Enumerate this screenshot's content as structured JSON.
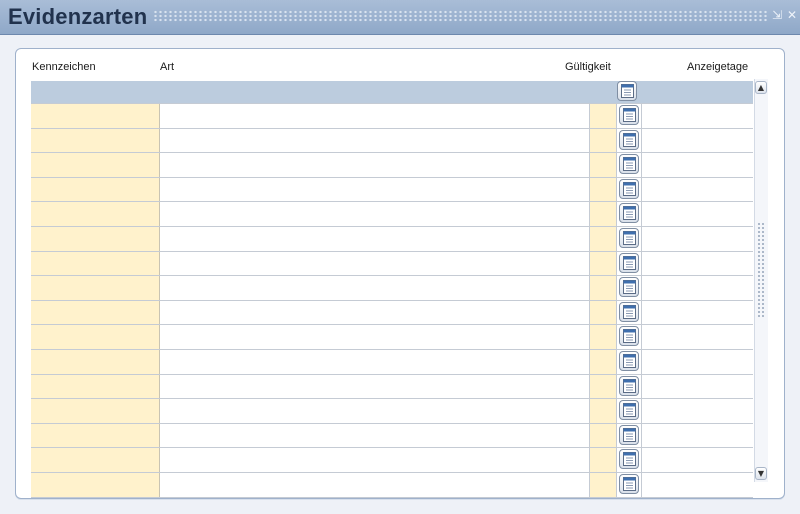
{
  "window": {
    "title": "Evidenzarten",
    "minimize_icon": "minimize-icon",
    "close_icon": "close-icon"
  },
  "table": {
    "columns": [
      "Kennzeichen",
      "Art",
      "Gültigkeit",
      "Anzeigetage"
    ],
    "calendar_icon": "calendar-icon",
    "rows": [
      {
        "kennzeichen": "",
        "art": "",
        "gueltigkeit": "",
        "anzeigetage": ""
      },
      {
        "kennzeichen": "",
        "art": "",
        "gueltigkeit": "",
        "anzeigetage": ""
      },
      {
        "kennzeichen": "",
        "art": "",
        "gueltigkeit": "",
        "anzeigetage": ""
      },
      {
        "kennzeichen": "",
        "art": "",
        "gueltigkeit": "",
        "anzeigetage": ""
      },
      {
        "kennzeichen": "",
        "art": "",
        "gueltigkeit": "",
        "anzeigetage": ""
      },
      {
        "kennzeichen": "",
        "art": "",
        "gueltigkeit": "",
        "anzeigetage": ""
      },
      {
        "kennzeichen": "",
        "art": "",
        "gueltigkeit": "",
        "anzeigetage": ""
      },
      {
        "kennzeichen": "",
        "art": "",
        "gueltigkeit": "",
        "anzeigetage": ""
      },
      {
        "kennzeichen": "",
        "art": "",
        "gueltigkeit": "",
        "anzeigetage": ""
      },
      {
        "kennzeichen": "",
        "art": "",
        "gueltigkeit": "",
        "anzeigetage": ""
      },
      {
        "kennzeichen": "",
        "art": "",
        "gueltigkeit": "",
        "anzeigetage": ""
      },
      {
        "kennzeichen": "",
        "art": "",
        "gueltigkeit": "",
        "anzeigetage": ""
      },
      {
        "kennzeichen": "",
        "art": "",
        "gueltigkeit": "",
        "anzeigetage": ""
      },
      {
        "kennzeichen": "",
        "art": "",
        "gueltigkeit": "",
        "anzeigetage": ""
      },
      {
        "kennzeichen": "",
        "art": "",
        "gueltigkeit": "",
        "anzeigetage": ""
      },
      {
        "kennzeichen": "",
        "art": "",
        "gueltigkeit": "",
        "anzeigetage": ""
      }
    ]
  },
  "scrollbar": {
    "up_icon": "scroll-up-icon",
    "down_icon": "scroll-down-icon"
  },
  "colors": {
    "titlebar": "#9cb2cf",
    "required_field": "#fff2cc",
    "header_band": "#bcccde"
  }
}
